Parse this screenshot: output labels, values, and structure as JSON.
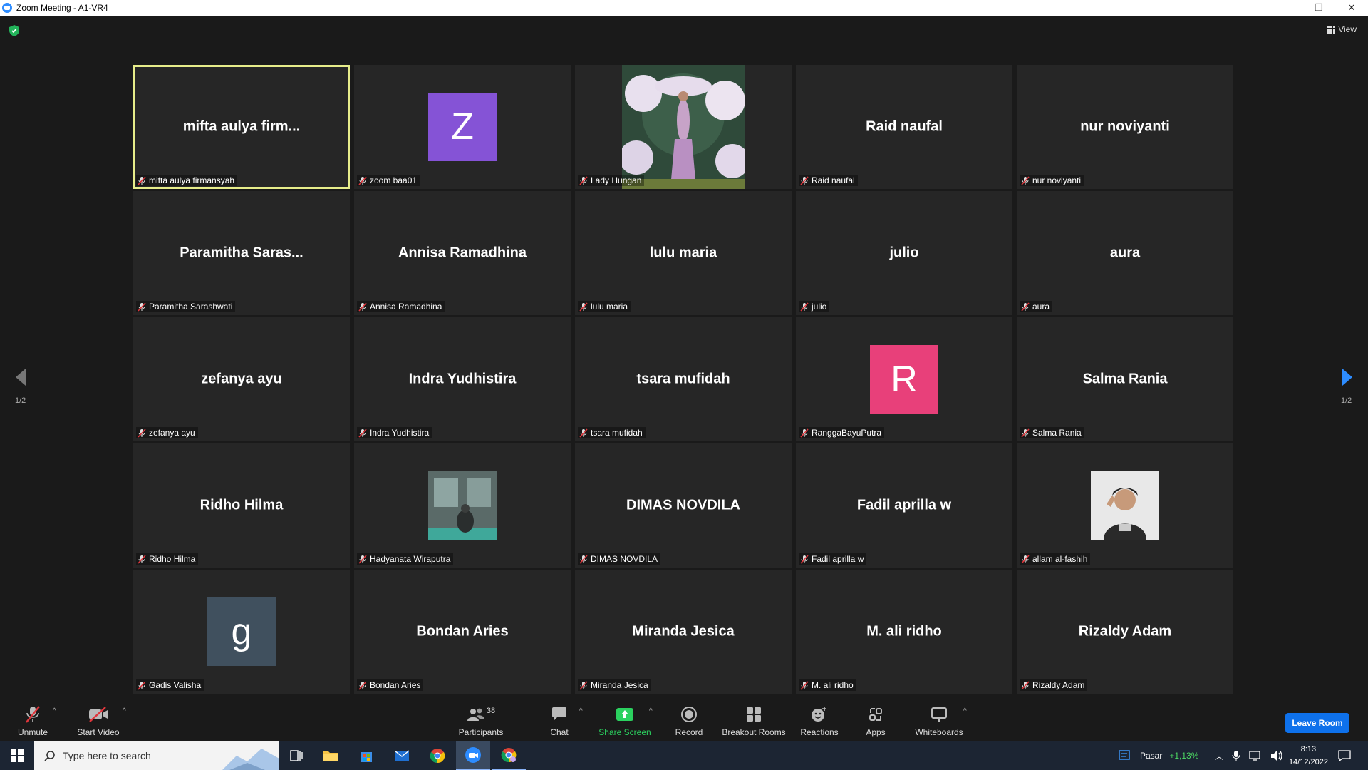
{
  "window": {
    "title": "Zoom Meeting - A1-VR4",
    "minimize": "—",
    "restore": "❐",
    "close": "✕"
  },
  "view_button": "View",
  "pager": {
    "left_label": "1/2",
    "right_label": "1/2"
  },
  "tiles": [
    {
      "big": "mifta  aulya  firm...",
      "label": "mifta aulya firmansyah",
      "active": true
    },
    {
      "avatar_letter": "Z",
      "avatar_color": "#8553d6",
      "label": "zoom baa01"
    },
    {
      "photo": "event-photo",
      "label": "Lady Hungan"
    },
    {
      "big": "Raid naufal",
      "label": "Raid naufal"
    },
    {
      "big": "nur noviyanti",
      "label": "nur noviyanti"
    },
    {
      "big": "Paramitha  Saras...",
      "label": "Paramitha Sarashwati"
    },
    {
      "big": "Annisa Ramadhina",
      "label": "Annisa Ramadhina"
    },
    {
      "big": "lulu maria",
      "label": "lulu maria"
    },
    {
      "big": "julio",
      "label": "julio"
    },
    {
      "big": "aura",
      "label": "aura"
    },
    {
      "big": "zefanya ayu",
      "label": "zefanya ayu"
    },
    {
      "big": "Indra Yudhistira",
      "label": "Indra Yudhistira"
    },
    {
      "big": "tsara mufidah",
      "label": "tsara mufidah"
    },
    {
      "avatar_letter": "R",
      "avatar_color": "#e8407a",
      "label": "RanggaBayuPutra"
    },
    {
      "big": "Salma Rania",
      "label": "Salma Rania"
    },
    {
      "big": "Ridho Hilma",
      "label": "Ridho Hilma"
    },
    {
      "photo": "room-photo",
      "label": "Hadyanata Wiraputra"
    },
    {
      "big": "DIMAS NOVDILA",
      "label": "DIMAS NOVDILA"
    },
    {
      "big": "Fadil aprilla w",
      "label": "Fadil aprilla w"
    },
    {
      "photo": "person-photo",
      "label": "allam al-fashih"
    },
    {
      "avatar_letter": "g",
      "avatar_color": "#40505e",
      "label": "Gadis Valisha"
    },
    {
      "big": "Bondan Aries",
      "label": "Bondan Aries"
    },
    {
      "big": "Miranda Jesica",
      "label": "Miranda Jesica"
    },
    {
      "big": "M. ali ridho",
      "label": "M. ali ridho"
    },
    {
      "big": "Rizaldy Adam",
      "label": "Rizaldy Adam"
    }
  ],
  "toolbar": {
    "unmute": "Unmute",
    "start_video": "Start Video",
    "participants": "Participants",
    "participants_count": "38",
    "chat": "Chat",
    "share_screen": "Share Screen",
    "record": "Record",
    "breakout_rooms": "Breakout Rooms",
    "reactions": "Reactions",
    "apps": "Apps",
    "whiteboards": "Whiteboards",
    "leave": "Leave Room"
  },
  "taskbar": {
    "search_placeholder": "Type here to search",
    "market_label": "Pasar",
    "market_change": "+1,13%",
    "time": "8:13",
    "date": "14/12/2022"
  },
  "colors": {
    "active_border": "#e6ec8a",
    "share_green": "#2bd15f",
    "leave_blue": "#0e71eb"
  }
}
